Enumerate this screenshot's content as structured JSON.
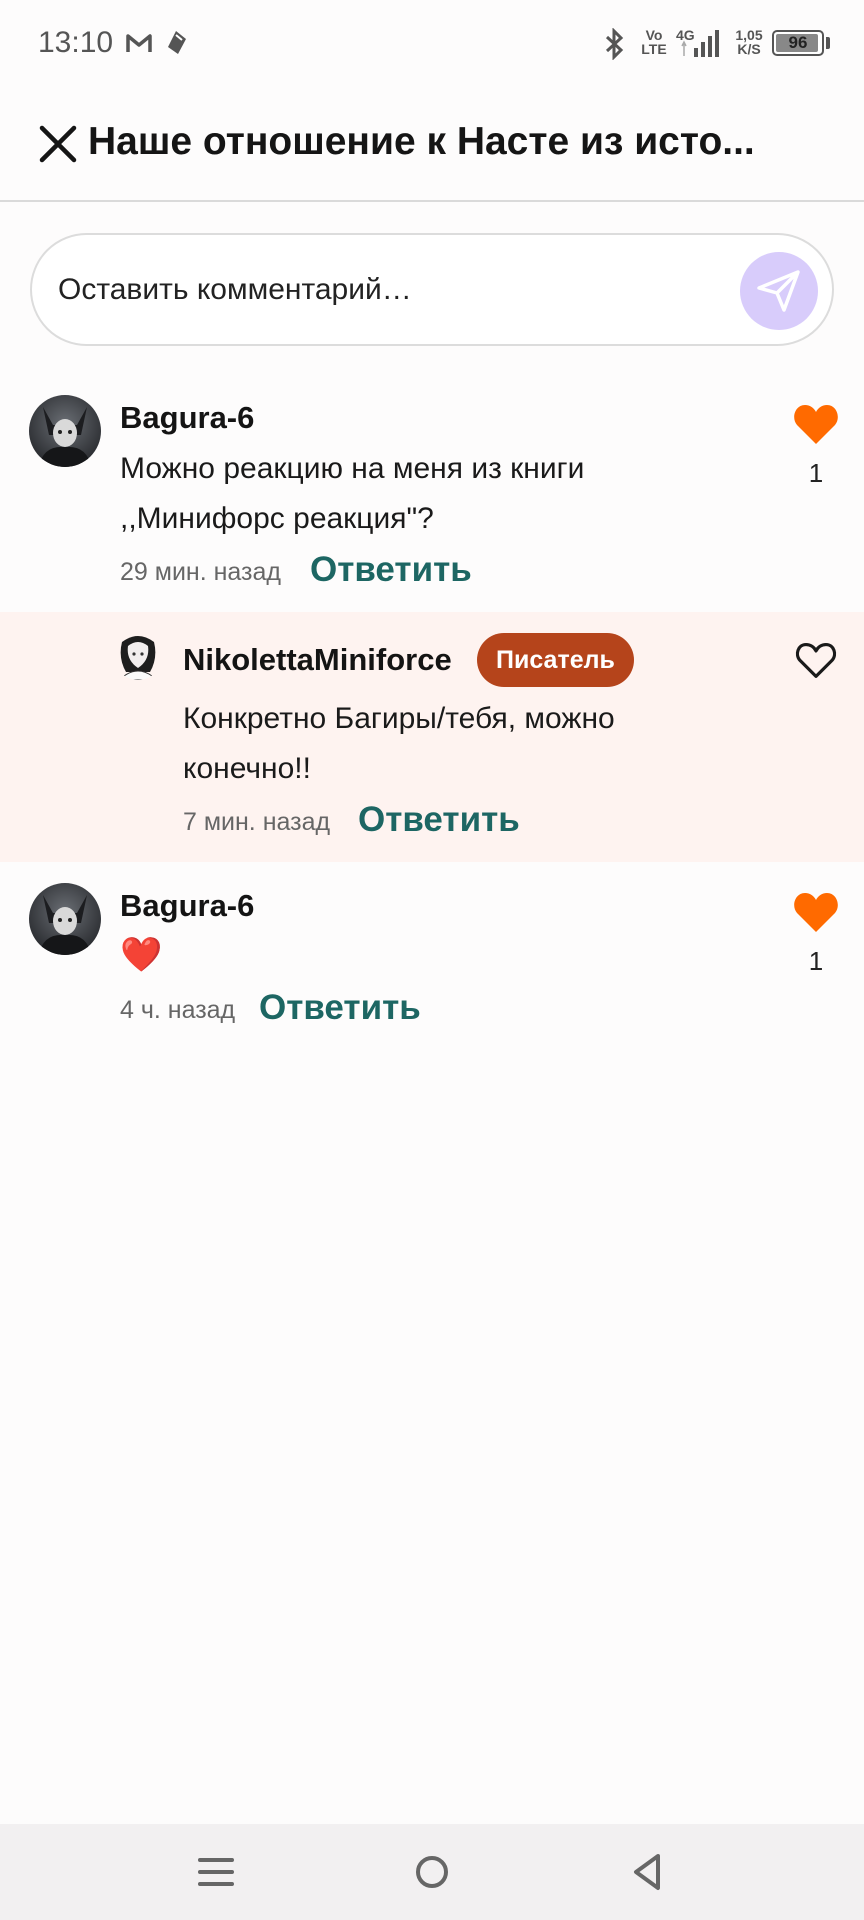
{
  "status_bar": {
    "time": "13:10",
    "network_top": "Vo",
    "network_bottom": "LTE",
    "network_type": "4G",
    "speed_value": "1,05",
    "speed_unit": "K/S",
    "battery": "96",
    "battery_level": 0.96
  },
  "header": {
    "title": "Наше отношение к Насте из исто..."
  },
  "comment_input": {
    "placeholder": "Оставить комментарий…"
  },
  "comments": [
    {
      "username": "Bagura-6",
      "text": "Можно реакцию на меня из книги ,,Минифорс реакция\"?",
      "time": "29 мин. назад",
      "reply_label": "Ответить",
      "likes": "1",
      "liked": true
    },
    {
      "username": "NikolettaMiniforce",
      "badge": "Писатель",
      "text": "Конкретно Багиры/тебя, можно конечно!!",
      "time": "7 мин. назад",
      "reply_label": "Ответить",
      "liked": false
    },
    {
      "username": "Bagura-6",
      "text": "❤️",
      "time": "4 ч. назад",
      "reply_label": "Ответить",
      "likes": "1",
      "liked": true
    }
  ],
  "colors": {
    "accent_like": "#ff6a00",
    "reply_link": "#1d6663",
    "badge_bg": "#b5441b",
    "send_button": "#d8ccfb",
    "reply_bg": "#fef3f0"
  },
  "icons": {
    "close": "close-icon",
    "send": "send-icon",
    "like_filled": "heart-filled-icon",
    "like_outline": "heart-outline-icon",
    "nav_menu": "menu-icon",
    "nav_home": "home-icon",
    "nav_back": "back-icon"
  }
}
